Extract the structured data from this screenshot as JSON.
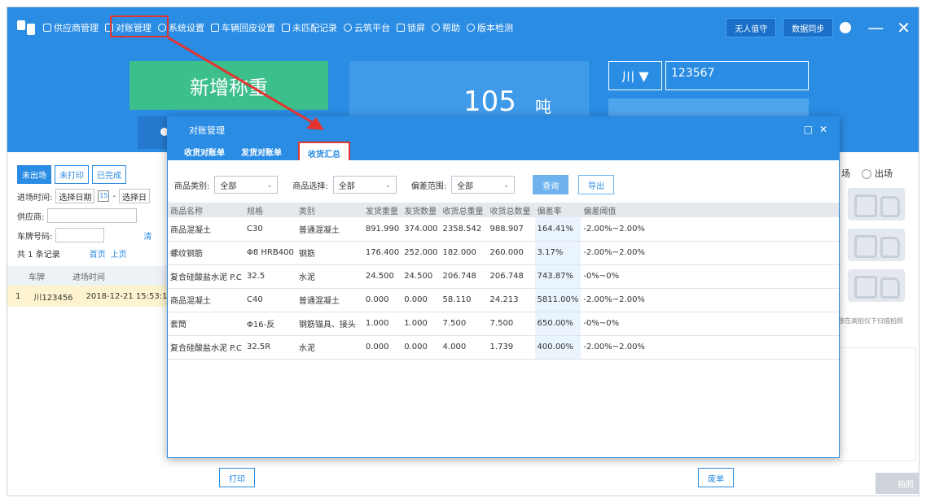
{
  "menubar": {
    "items": [
      {
        "label": "供应商管理",
        "icon": "list-icon"
      },
      {
        "label": "对账管理",
        "icon": "document-icon"
      },
      {
        "label": "系统设置",
        "icon": "gear-icon"
      },
      {
        "label": "车辆回皮设置",
        "icon": "truck-icon"
      },
      {
        "label": "未匹配记录",
        "icon": "truck-icon"
      },
      {
        "label": "云筑平台",
        "icon": "cloud-icon"
      },
      {
        "label": "锁屏",
        "icon": "lock-icon"
      },
      {
        "label": "帮助",
        "icon": "help-icon"
      },
      {
        "label": "版本检测",
        "icon": "info-icon"
      }
    ],
    "unattended_label": "无人值守",
    "sync_label": "数据同步"
  },
  "main": {
    "new_weigh_label": "新增称重",
    "weight_value": "105",
    "weight_unit": "吨",
    "plate_province": "川",
    "plate_number": "123567"
  },
  "left": {
    "tabs": [
      "未出场",
      "未打印",
      "已完成"
    ],
    "entry_time_label": "进场时间:",
    "date_placeholder": "选择日期",
    "date_placeholder2": "选择日",
    "supplier_label": "供应商:",
    "plate_label": "车牌号码:",
    "clear_label": "清",
    "count_text": "共 1 条记录",
    "first_page": "首页",
    "prev_page": "上页",
    "col_plate": "车牌",
    "col_time": "进场时间",
    "row": {
      "idx": "1",
      "plate": "川123456",
      "time": "2018-12-21 15:53:1"
    }
  },
  "right": {
    "radio_in": "场",
    "radio_out": "出场",
    "hint": "放在高拍仪下扫描拍照",
    "photo_label": "拍照"
  },
  "bottom": {
    "print_label": "打印",
    "void_label": "废单"
  },
  "modal": {
    "title": "对账管理",
    "tabs": [
      "收货对账单",
      "发货对账单",
      "收货汇总"
    ],
    "filters": {
      "category_label": "商品类别:",
      "category_value": "全部",
      "product_label": "商品选择:",
      "product_value": "全部",
      "deviation_label": "偏差范围:",
      "deviation_value": "全部",
      "query_label": "查询",
      "export_label": "导出"
    },
    "columns": [
      "商品名称",
      "规格",
      "类别",
      "发货重量",
      "发货数量",
      "收货总重量",
      "收货总数量",
      "偏差率",
      "偏差阈值"
    ],
    "rows": [
      [
        "商品混凝土",
        "C30",
        "普通混凝土",
        "891.990",
        "374.000",
        "2358.542",
        "988.907",
        "164.41%",
        "-2.00%~2.00%"
      ],
      [
        "螺纹钢筋",
        "Φ8 HRB400",
        "钢筋",
        "176.400",
        "252.000",
        "182.000",
        "260.000",
        "3.17%",
        "-2.00%~2.00%"
      ],
      [
        "复合硅酸盐水泥 P.C",
        "32.5",
        "水泥",
        "24.500",
        "24.500",
        "206.748",
        "206.748",
        "743.87%",
        "-0%~0%"
      ],
      [
        "商品混凝土",
        "C40",
        "普通混凝土",
        "0.000",
        "0.000",
        "58.110",
        "24.213",
        "5811.00%",
        "-2.00%~2.00%"
      ],
      [
        "套筒",
        "Φ16-反",
        "钢筋锚具、接头",
        "1.000",
        "1.000",
        "7.500",
        "7.500",
        "650.00%",
        "-0%~0%"
      ],
      [
        "复合硅酸盐水泥 P.C",
        "32.5R",
        "水泥",
        "0.000",
        "0.000",
        "4.000",
        "1.739",
        "400.00%",
        "-2.00%~2.00%"
      ]
    ]
  },
  "colors": {
    "primary": "#2a8ce3",
    "green": "#3dbf8c",
    "highlight": "#e3342f"
  }
}
